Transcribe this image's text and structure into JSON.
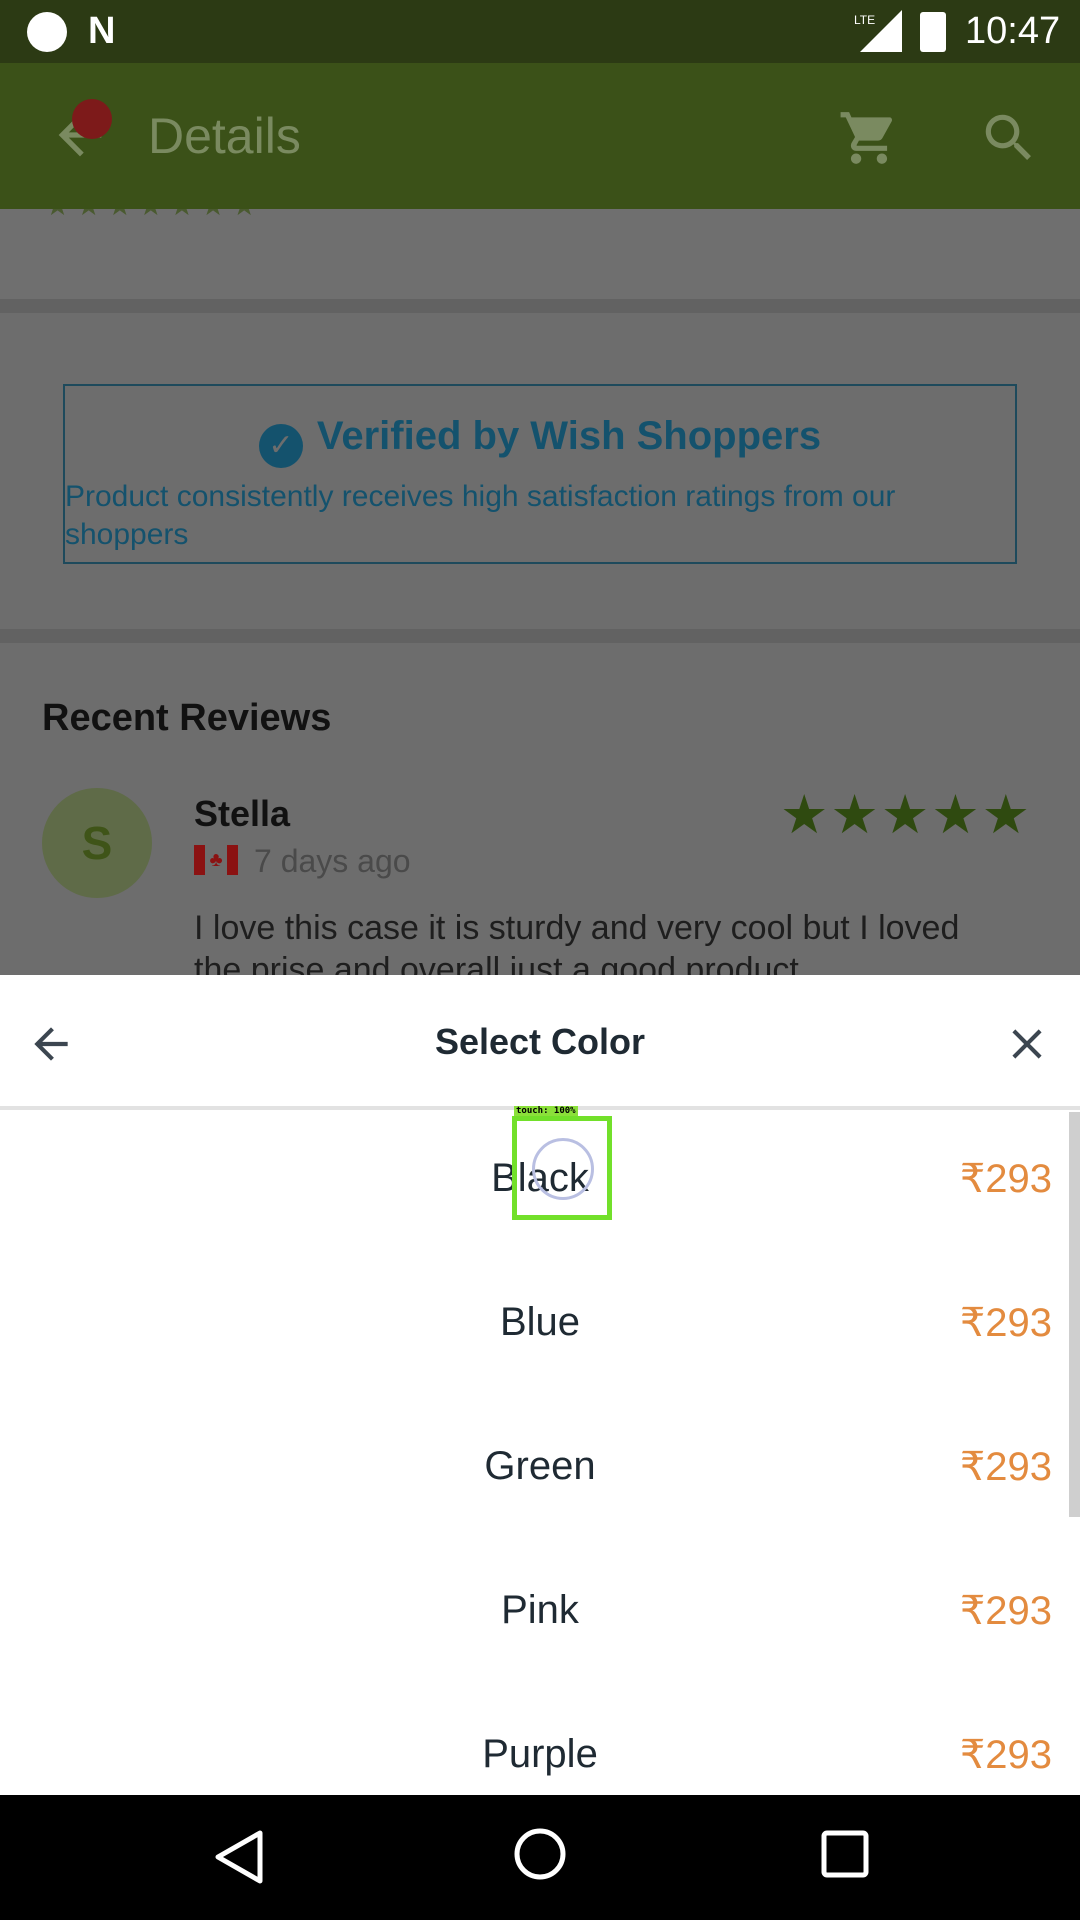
{
  "status_bar": {
    "time": "10:47",
    "network": "LTE"
  },
  "app_bar": {
    "title": "Details"
  },
  "verified": {
    "title": "Verified by Wish Shoppers",
    "description": "Product consistently receives high satisfaction ratings from our shoppers"
  },
  "reviews": {
    "heading": "Recent Reviews",
    "items": [
      {
        "avatar_letter": "S",
        "name": "Stella",
        "date": "7 days ago",
        "stars": "★★★★★",
        "rating": 5,
        "text": "I love this case it is sturdy and very cool but I loved the prise and overall just a good product"
      }
    ]
  },
  "sheet": {
    "title": "Select Color",
    "options": [
      {
        "name": "Black",
        "price": "₹293"
      },
      {
        "name": "Blue",
        "price": "₹293"
      },
      {
        "name": "Green",
        "price": "₹293"
      },
      {
        "name": "Pink",
        "price": "₹293"
      },
      {
        "name": "Purple",
        "price": "₹293"
      }
    ]
  },
  "touch_indicator": {
    "label": "touch: 100%"
  },
  "colors": {
    "app_bar": "#3b5118",
    "status_bar": "#2c3a14",
    "price": "#e38b3f",
    "verified": "#14526d",
    "stars": "#2f4a10",
    "touch": "#72e02a"
  }
}
